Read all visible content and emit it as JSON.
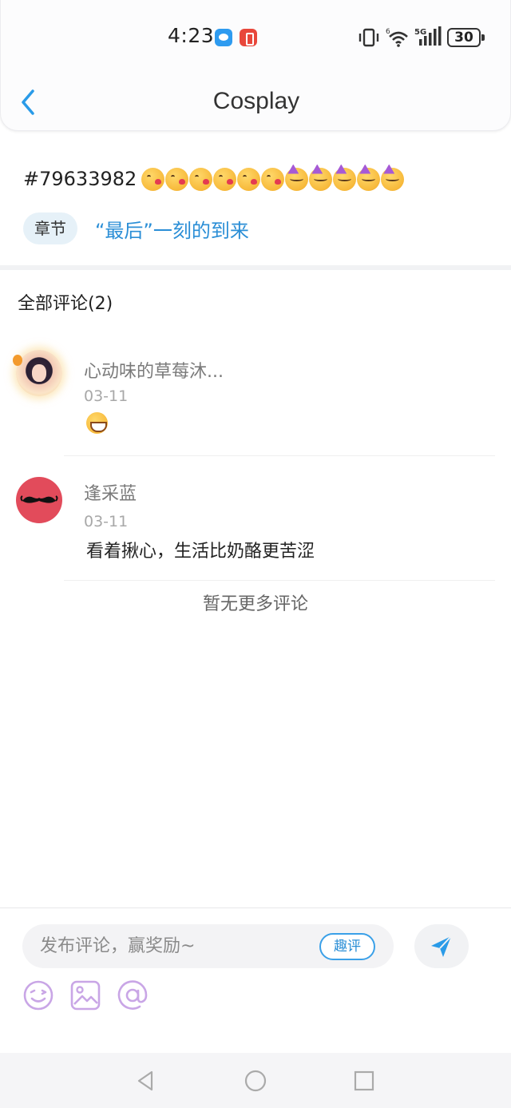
{
  "status_bar": {
    "time": "4:23",
    "icons": [
      "message-notification-icon",
      "app-notification-icon",
      "vibrate-icon",
      "wifi-6-icon",
      "signal-5g-icon",
      "battery-icon"
    ],
    "battery": "30"
  },
  "header": {
    "title": "Cosplay",
    "back_icon": "chevron-left-icon"
  },
  "post": {
    "id": "#79633982",
    "emojis": [
      "kissing-face",
      "kissing-face",
      "kissing-face",
      "kissing-face",
      "kissing-face",
      "kissing-face",
      "partying-face",
      "partying-face",
      "partying-face",
      "partying-face",
      "partying-face"
    ],
    "chapter_tag": "章节",
    "chapter_title": "“最后”一刻的到来"
  },
  "comments": {
    "title": "全部评论(2)",
    "items": [
      {
        "user": "心动味的草莓沐...",
        "date": "03-11",
        "body_emoji": "grinning-face",
        "avatar": "anime-girl-avatar"
      },
      {
        "user": "逢采蓝",
        "date": "03-11",
        "body": "看着揪心，生活比奶酪更苦涩",
        "avatar": "mustache-avatar"
      }
    ],
    "no_more": "暂无更多评论"
  },
  "input_panel": {
    "placeholder": "发布评论，赢奖励~",
    "quping_label": "趣评",
    "send_icon": "send-icon",
    "tools": [
      "emoji-icon",
      "image-icon",
      "mention-icon"
    ]
  },
  "nav_bar": {
    "buttons": [
      "back-triangle-icon",
      "home-circle-icon",
      "recents-square-icon"
    ]
  },
  "colors": {
    "accent_blue": "#2a8ed6",
    "tool_purple": "#c9a6e6",
    "avatar_red": "#e24b5b"
  }
}
